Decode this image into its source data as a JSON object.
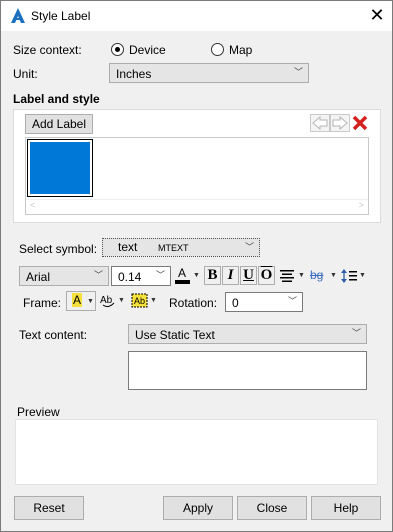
{
  "window": {
    "title": "Style Label"
  },
  "size_context": {
    "label": "Size context:",
    "options": [
      {
        "label": "Device",
        "selected": true
      },
      {
        "label": "Map",
        "selected": false
      }
    ]
  },
  "unit": {
    "label": "Unit:",
    "value": "Inches"
  },
  "label_and_style": {
    "heading": "Label and style",
    "add_label_button": "Add Label",
    "swatch_color": "#0078d7"
  },
  "select_symbol": {
    "label": "Select symbol:",
    "sample_text": "text",
    "symbol_type": "MTEXT"
  },
  "format": {
    "font": "Arial",
    "size": "0.14",
    "font_color_letter": "A",
    "bold": "B",
    "italic": "I",
    "underline": "U",
    "overline": "O",
    "background_label": "bg"
  },
  "frame": {
    "label": "Frame:",
    "fill_letter": "A"
  },
  "rotation": {
    "label": "Rotation:",
    "value": "0"
  },
  "text_content": {
    "label": "Text content:",
    "value": "Use Static Text",
    "text": ""
  },
  "preview": {
    "label": "Preview"
  },
  "buttons": {
    "reset": "Reset",
    "apply": "Apply",
    "close": "Close",
    "help": "Help"
  }
}
